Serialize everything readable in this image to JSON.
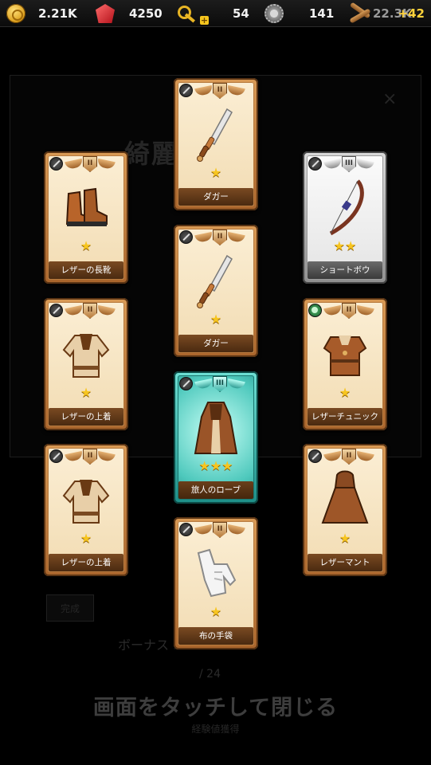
{
  "resources": {
    "gold": "2.21K",
    "gems": "4250",
    "keys": "54",
    "gears": "141",
    "wood": "22.3K",
    "wood_bonus": "+42"
  },
  "background": {
    "shop_title": "綺麗 台屋",
    "close_glyph": "×",
    "tag_label": "完成",
    "bonus_text": "ボーナス 50%",
    "small_text": "/ 24",
    "tap_to_close": "画面をタッチして閉じる",
    "footer_text": "経験値獲得"
  },
  "cards": [
    {
      "id": "dagger-1",
      "name": "ダガー",
      "rank": "II",
      "stars": "★",
      "frame": "bronze",
      "category": "weapon"
    },
    {
      "id": "leather-boots",
      "name": "レザーの長靴",
      "rank": "II",
      "stars": "★",
      "frame": "bronze",
      "category": "weapon"
    },
    {
      "id": "short-bow",
      "name": "ショートボウ",
      "rank": "III",
      "stars": "★★",
      "frame": "silver",
      "category": "weapon"
    },
    {
      "id": "dagger-2",
      "name": "ダガー",
      "rank": "II",
      "stars": "★",
      "frame": "bronze",
      "category": "weapon"
    },
    {
      "id": "leather-jacket-1",
      "name": "レザーの上着",
      "rank": "II",
      "stars": "★",
      "frame": "bronze",
      "category": "weapon"
    },
    {
      "id": "leather-tunic",
      "name": "レザーチュニック",
      "rank": "II",
      "stars": "★",
      "frame": "bronze",
      "category": "armor"
    },
    {
      "id": "traveler-robe",
      "name": "旅人のローブ",
      "rank": "III",
      "stars": "★★★",
      "frame": "teal",
      "category": "weapon"
    },
    {
      "id": "leather-jacket-2",
      "name": "レザーの上着",
      "rank": "II",
      "stars": "★",
      "frame": "bronze",
      "category": "weapon"
    },
    {
      "id": "leather-mantle",
      "name": "レザーマント",
      "rank": "II",
      "stars": "★",
      "frame": "bronze",
      "category": "weapon"
    },
    {
      "id": "cloth-gloves",
      "name": "布の手袋",
      "rank": "II",
      "stars": "★",
      "frame": "bronze",
      "category": "weapon"
    }
  ]
}
